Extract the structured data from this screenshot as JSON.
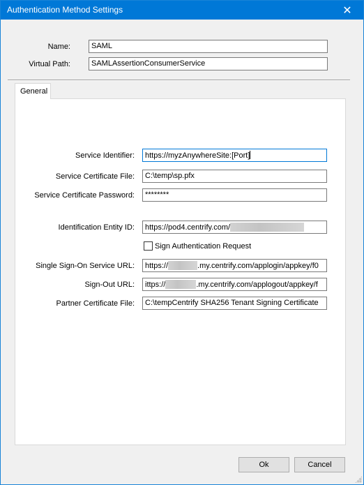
{
  "window": {
    "title": "Authentication Method Settings",
    "close_glyph": "✕"
  },
  "header": {
    "name_label": "Name:",
    "name_value": "SAML",
    "virtual_path_label": "Virtual Path:",
    "virtual_path_value": "SAMLAssertionConsumerService"
  },
  "tabs": [
    {
      "label": "General",
      "selected": true
    }
  ],
  "general": {
    "service_identifier_label": "Service Identifier:",
    "service_identifier_value": "https://myzAnywhereSite:[Port]",
    "service_cert_file_label": "Service Certificate File:",
    "service_cert_file_value": "C:\\temp\\sp.pfx",
    "service_cert_password_label": "Service Certificate Password:",
    "service_cert_password_value": "********",
    "identification_entity_id_label": "Identification Entity ID:",
    "identification_entity_id_value": "https://pod4.centrify.com/",
    "sign_auth_request_label": "Sign Authentication Request",
    "sign_auth_request_checked": false,
    "sso_service_url_label": "Single Sign-On Service URL:",
    "sso_service_url_prefix": "https://",
    "sso_service_url_suffix": ".my.centrify.com/applogin/appkey/f0",
    "sign_out_url_label": "Sign-Out URL:",
    "sign_out_url_prefix": "ittps://",
    "sign_out_url_suffix": ".my.centrify.com/applogout/appkey/f",
    "partner_cert_file_label": "Partner Certificate File:",
    "partner_cert_file_value": "C:\\tempCentrify SHA256 Tenant Signing Certificate"
  },
  "buttons": {
    "ok_label": "Ok",
    "cancel_label": "Cancel"
  },
  "colors": {
    "titlebar": "#0078d7",
    "dialog_bg": "#f0f0f0",
    "focus_border": "#0078d7"
  }
}
